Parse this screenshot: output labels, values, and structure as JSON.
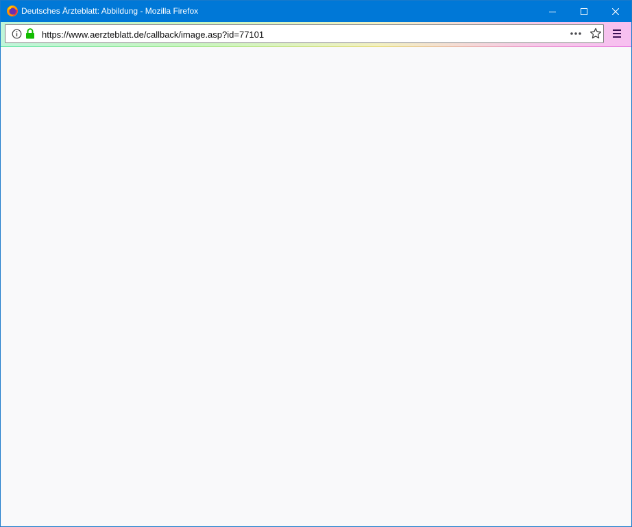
{
  "window": {
    "title": "Deutsches Ärzteblatt: Abbildung - Mozilla Firefox",
    "app_icon": "firefox-icon",
    "controls": {
      "minimize_icon": "minimize-icon",
      "maximize_icon": "maximize-icon",
      "close_icon": "close-icon"
    }
  },
  "navbar": {
    "url": "https://www.aerzteblatt.de/callback/image.asp?id=77101",
    "site_info_icon": "info-icon",
    "secure_icon": "lock-icon",
    "page_actions_icon": "more-icon",
    "bookmark_icon": "star-icon",
    "menu_icon": "hamburger-menu-icon"
  },
  "content": {
    "background": "#f9f9fa"
  },
  "colors": {
    "titlebar": "#0078d7",
    "lock_green": "#12bc00"
  }
}
